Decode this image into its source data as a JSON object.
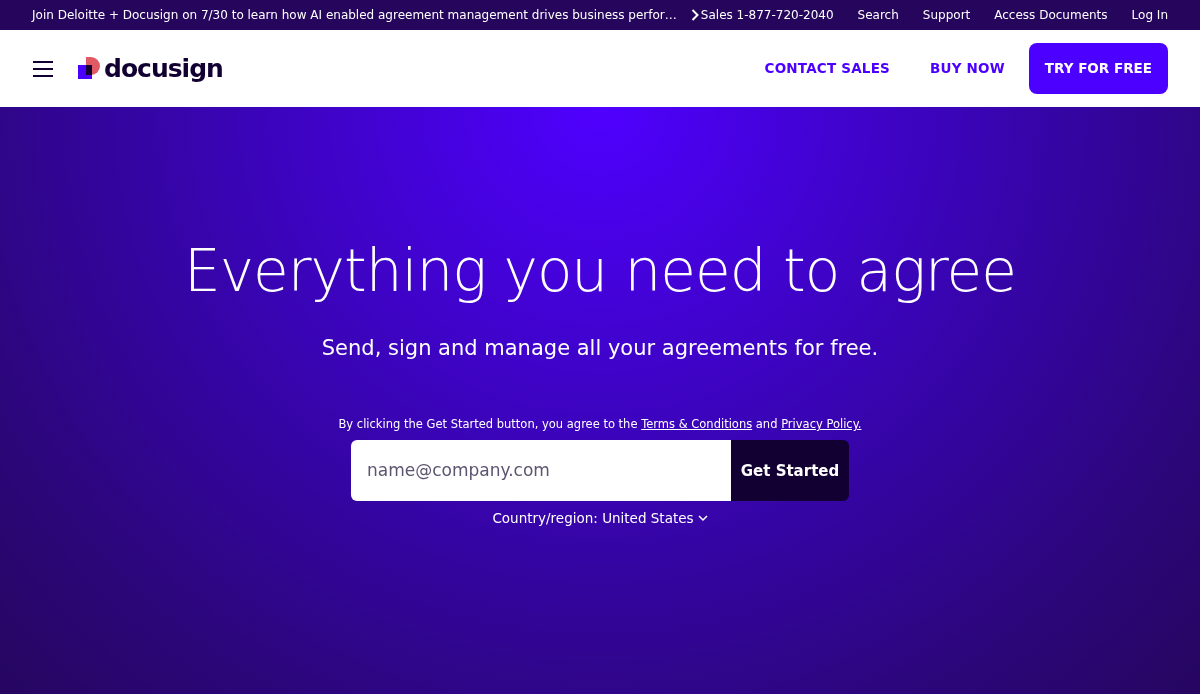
{
  "announcement": {
    "text": "Join Deloitte + Docusign on 7/30 to learn how AI enabled agreement management drives business perfor…"
  },
  "utility_links": [
    "Sales 1-877-720-2040",
    "Search",
    "Support",
    "Access Documents",
    "Log In"
  ],
  "header": {
    "logo": "docusign",
    "links": [
      "CONTACT SALES",
      "BUY NOW"
    ],
    "cta": "TRY FOR FREE"
  },
  "hero": {
    "title": "Everything you need to agree",
    "subtitle": "Send, sign and manage all your agreements for free.",
    "consent": {
      "prefix": "By clicking the Get Started button, you agree to the",
      "terms_link": "Terms & Conditions",
      "joiner": "and",
      "privacy_link": "Privacy Policy."
    },
    "email": {
      "placeholder": "name@company.com"
    },
    "button": "Get Started",
    "country": "Country/region: United States"
  }
}
